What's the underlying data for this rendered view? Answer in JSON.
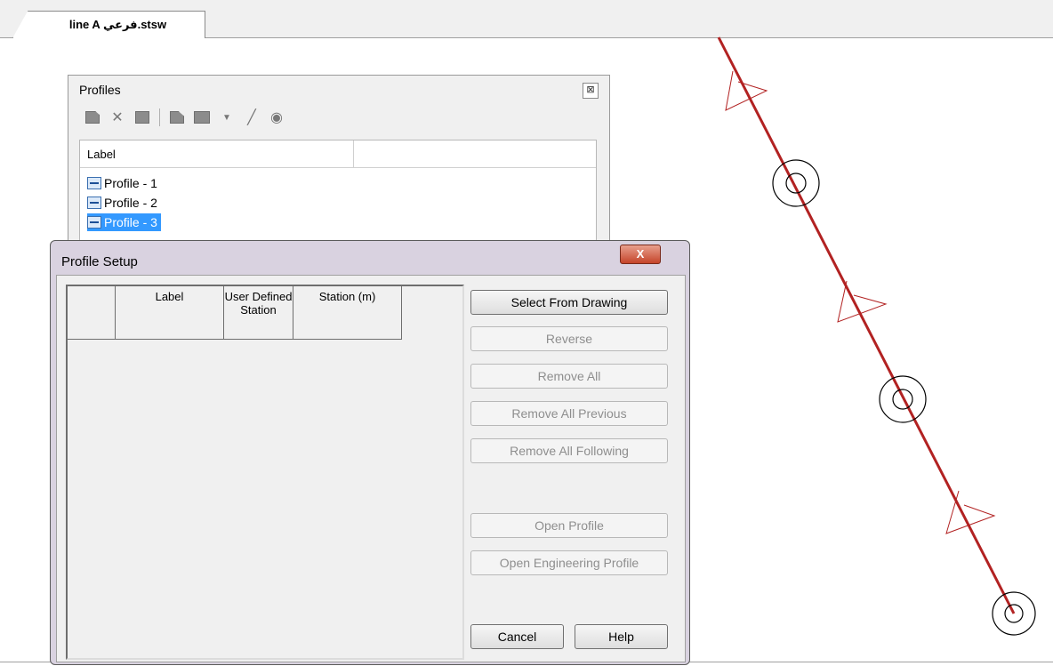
{
  "document_tab": {
    "label": "line A فرعي.stsw"
  },
  "profiles_palette": {
    "title": "Profiles",
    "close_glyph": "⊠",
    "toolbar_icons": [
      "new-profile-icon",
      "delete-icon",
      "profile-view-icon",
      "edit-profile-icon",
      "profile-dropdown-icon",
      "chevron-down-icon",
      "edit-pencil-icon",
      "help-icon"
    ],
    "list_header": "Label",
    "items": [
      {
        "label": "Profile - 1",
        "selected": false
      },
      {
        "label": "Profile - 2",
        "selected": false
      },
      {
        "label": "Profile - 3",
        "selected": true
      }
    ]
  },
  "profile_setup": {
    "title": "Profile Setup",
    "close_label": "X",
    "columns": [
      "",
      "Label",
      "User Defined Station",
      "Station (m)"
    ],
    "rows": [],
    "buttons": {
      "select_from_drawing": "Select From Drawing",
      "reverse": "Reverse",
      "remove_all": "Remove All",
      "remove_all_previous": "Remove All Previous",
      "remove_all_following": "Remove All Following",
      "open_profile": "Open Profile",
      "open_engineering_profile": "Open Engineering Profile",
      "cancel": "Cancel",
      "help": "Help"
    }
  },
  "colors": {
    "pipeline": "#b22222",
    "selection": "#3399ff",
    "dialog_frame": "#d9d2e0"
  }
}
